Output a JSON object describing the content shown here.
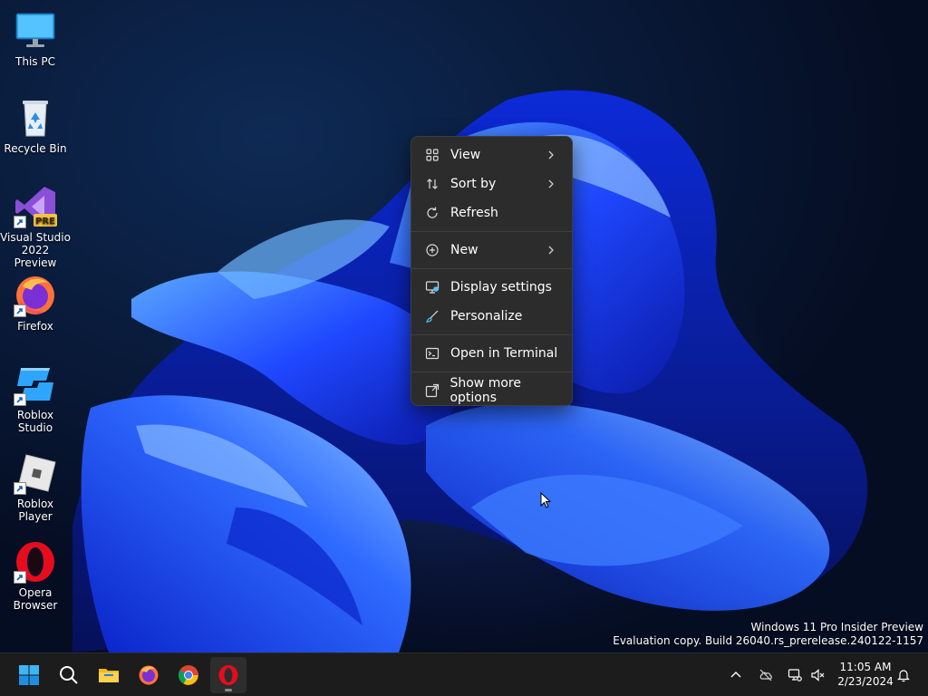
{
  "desktop": {
    "icons": [
      {
        "label": "This PC",
        "icon": "monitor-icon"
      },
      {
        "label": "Recycle Bin",
        "icon": "recycle-bin-icon"
      },
      {
        "label": "Visual Studio 2022 Preview",
        "icon": "visual-studio-icon",
        "badge": "PRE"
      },
      {
        "label": "Firefox",
        "icon": "firefox-icon"
      },
      {
        "label": "Roblox Studio",
        "icon": "roblox-studio-icon"
      },
      {
        "label": "Roblox Player",
        "icon": "roblox-player-icon"
      },
      {
        "label": "Opera Browser",
        "icon": "opera-icon"
      }
    ]
  },
  "context_menu": {
    "items": [
      {
        "label": "View",
        "icon": "grid-icon",
        "submenu": true
      },
      {
        "label": "Sort by",
        "icon": "sort-icon",
        "submenu": true
      },
      {
        "label": "Refresh",
        "icon": "refresh-icon",
        "submenu": false
      },
      {
        "label": "New",
        "icon": "plus-circle-icon",
        "submenu": true
      },
      {
        "label": "Display settings",
        "icon": "display-settings-icon",
        "submenu": false
      },
      {
        "label": "Personalize",
        "icon": "brush-icon",
        "submenu": false
      },
      {
        "label": "Open in Terminal",
        "icon": "terminal-icon",
        "submenu": false
      },
      {
        "label": "Show more options",
        "icon": "show-more-icon",
        "submenu": false
      }
    ]
  },
  "watermark": {
    "line1": "Windows 11 Pro Insider Preview",
    "line2": "Evaluation copy. Build 26040.rs_prerelease.240122-1157"
  },
  "taskbar": {
    "apps": [
      "start-icon",
      "search-icon",
      "file-explorer-icon",
      "firefox-icon",
      "chrome-icon",
      "opera-icon"
    ],
    "active_app": "opera-icon",
    "tray": [
      "chevron-up-icon",
      "onedrive-offline-icon",
      "network-icon",
      "volume-muted-icon"
    ],
    "clock": {
      "time": "11:05 AM",
      "date": "2/23/2024"
    }
  },
  "colors": {
    "accent": "#0078d4",
    "menu_bg": "#2c2c2c",
    "taskbar_bg": "#1c1c1c",
    "bloom_blue": "#1a3cff"
  }
}
